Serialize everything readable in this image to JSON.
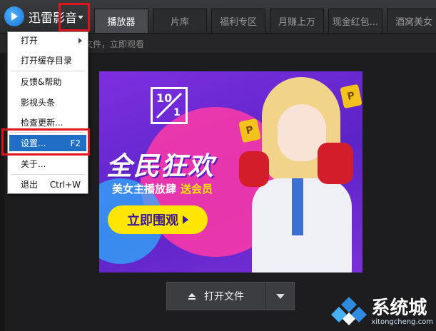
{
  "app": {
    "title": "迅雷影音"
  },
  "tabs": [
    {
      "label": "播放器",
      "active": true
    },
    {
      "label": "片库",
      "active": false
    },
    {
      "label": "福利专区",
      "active": false
    },
    {
      "label": "月赚上万",
      "active": false
    },
    {
      "label": "现金红包...",
      "active": false
    },
    {
      "label": "酒窝美女",
      "active": false
    }
  ],
  "hint": {
    "text": "文件，立即观看"
  },
  "menu": {
    "items": [
      {
        "label": "打开",
        "shortcut": ""
      },
      {
        "label": "打开缓存目录",
        "shortcut": ""
      },
      {
        "label": "反馈&帮助",
        "shortcut": ""
      },
      {
        "label": "影视头条",
        "shortcut": ""
      },
      {
        "label": "检查更新...",
        "shortcut": ""
      },
      {
        "label": "设置...",
        "shortcut": "F2"
      },
      {
        "label": "关于...",
        "shortcut": ""
      },
      {
        "label": "退出",
        "shortcut": "Ctrl+W"
      }
    ],
    "selected_index": 5
  },
  "banner": {
    "badge_top": "10",
    "badge_bottom": "1",
    "slogan": "全民狂欢",
    "subslogan": "美女主播放肆",
    "subslogan_highlight": "送会员",
    "cta": "立即围观",
    "coin_letter": "P"
  },
  "open_button": {
    "label": "打开文件"
  },
  "watermark": {
    "cn": "系统城",
    "en": "xitongcheng.com"
  },
  "colors": {
    "selected": "#1f6dc4",
    "highlight_frame": "#e0141c",
    "banner_bg": "#6a2ad8",
    "cta": "#ffe600"
  }
}
